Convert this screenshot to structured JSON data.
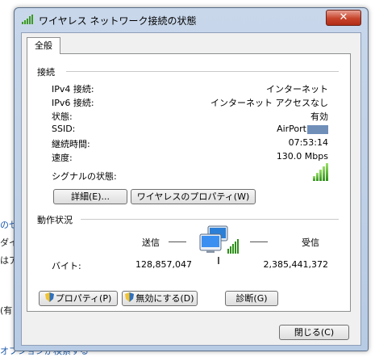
{
  "window": {
    "title": "ワイヤレス ネットワーク接続の状態",
    "close_label": "✕"
  },
  "tab": {
    "label": "全般"
  },
  "connection": {
    "section_title": "接続",
    "rows": [
      {
        "label": "IPv4 接続:",
        "value": "インターネット"
      },
      {
        "label": "IPv6 接続:",
        "value": "インターネット アクセスなし"
      },
      {
        "label": "状態:",
        "value": "有効"
      },
      {
        "label": "SSID:",
        "value": "AirPort"
      },
      {
        "label": "継続時間:",
        "value": "07:53:14"
      },
      {
        "label": "速度:",
        "value": "130.0 Mbps"
      }
    ],
    "signal_label": "シグナルの状態:",
    "details_button": "詳細(E)...",
    "wireless_props_button": "ワイヤレスのプロパティ(W)"
  },
  "activity": {
    "section_title": "動作状況",
    "sent_label": "送信",
    "received_label": "受信",
    "bytes_label": "バイト:",
    "sent_bytes": "128,857,047",
    "received_bytes": "2,385,441,372"
  },
  "buttons": {
    "properties": "プロパティ(P)",
    "disable": "無効にする(D)",
    "diagnose": "診断(G)",
    "close": "閉じる(C)"
  },
  "background": {
    "line1": "のセ",
    "line2": "ダイ",
    "line3": "はア",
    "line4": "(有",
    "bottom_link": "オプションが検索する"
  },
  "colors": {
    "signal_green": "#2f8f1a",
    "close_red": "#c7432a",
    "frame_blue": "#b7cbe4"
  }
}
